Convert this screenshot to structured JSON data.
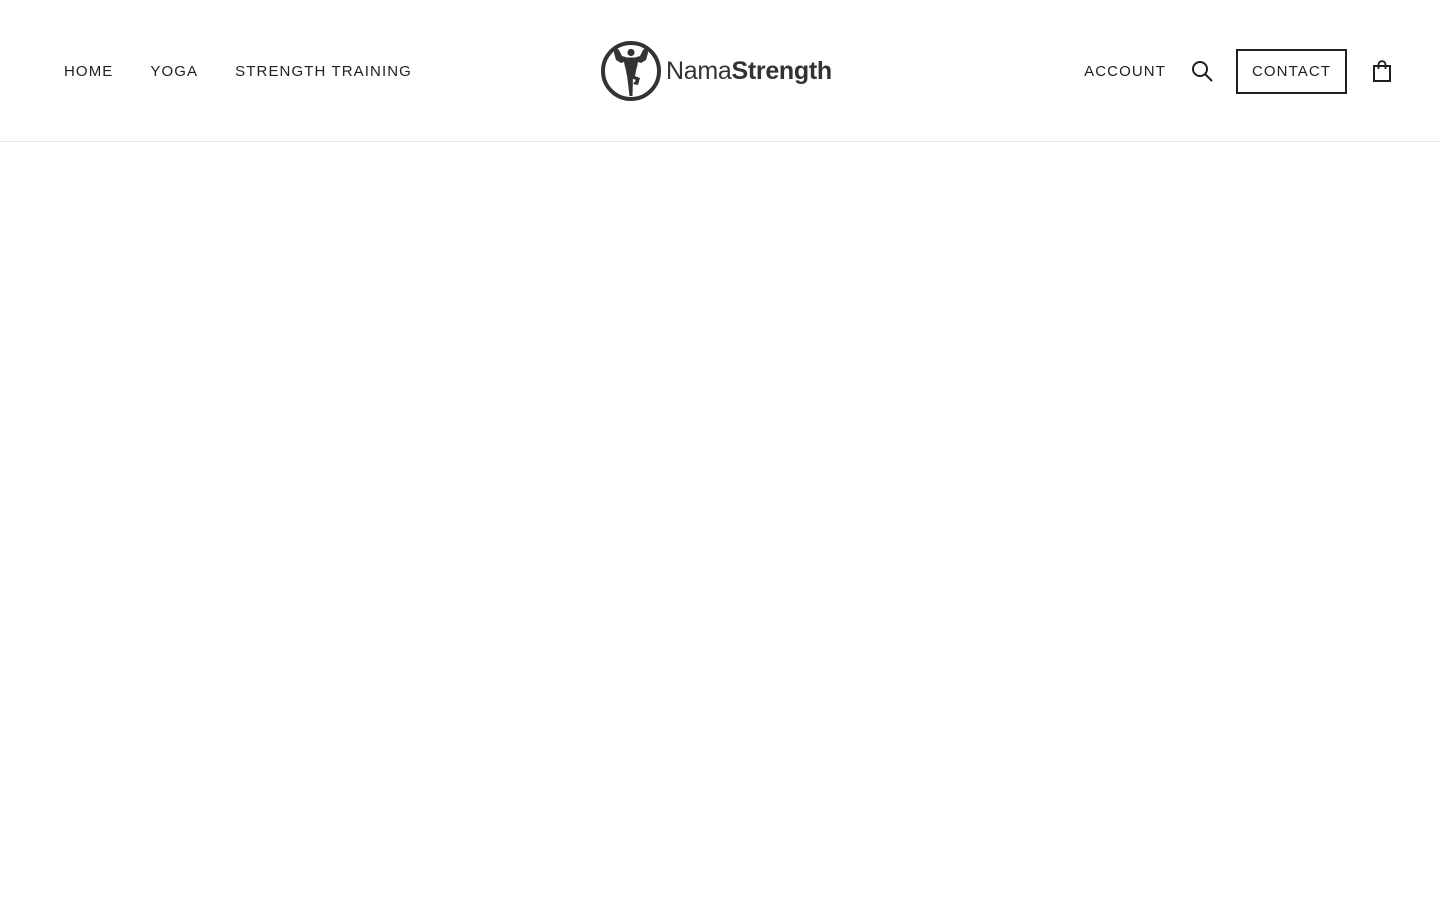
{
  "nav": {
    "left": [
      {
        "label": "HOME"
      },
      {
        "label": "YOGA"
      },
      {
        "label": "STRENGTH TRAINING"
      }
    ],
    "account_label": "ACCOUNT",
    "contact_label": "CONTACT"
  },
  "logo": {
    "part1": "Nama",
    "part2": "Strength"
  },
  "icons": {
    "search": "search-icon",
    "cart": "shopping-bag-icon",
    "logo": "muscle-figure-logo-icon"
  },
  "colors": {
    "text": "#1f1f1f",
    "logo": "#333333",
    "border": "#e9e9e9",
    "background": "#ffffff"
  }
}
